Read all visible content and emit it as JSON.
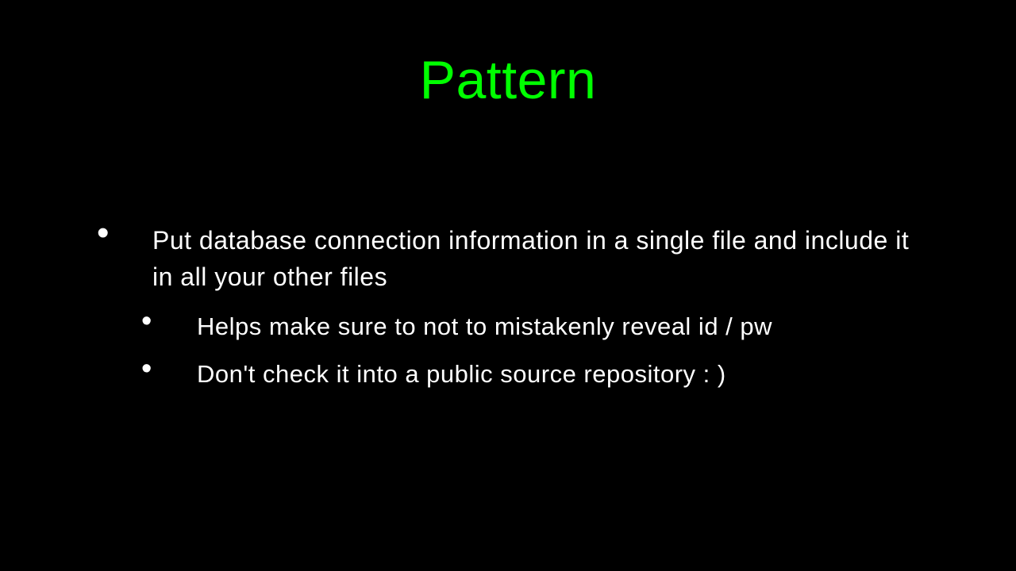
{
  "slide": {
    "title": "Pattern",
    "bullets": [
      {
        "text": "Put database connection information in a single file and include it in all your other files",
        "children": [
          {
            "text": "Helps make sure to not to mistakenly reveal id / pw"
          },
          {
            "text": "Don't check it into a public source repository : )"
          }
        ]
      }
    ]
  },
  "colors": {
    "background": "#000000",
    "title": "#00ff00",
    "body_text": "#ffffff"
  }
}
